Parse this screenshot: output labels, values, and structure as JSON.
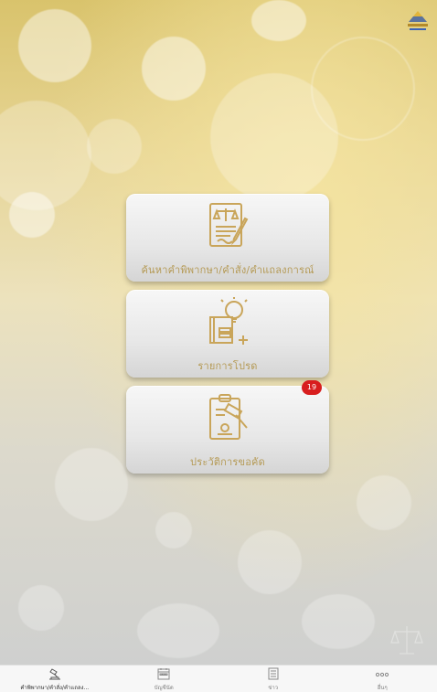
{
  "colors": {
    "gold": "#c9a55a",
    "badge": "#d81e1e",
    "label": "#b59a55"
  },
  "logo": {
    "icon": "court-logo-icon"
  },
  "menu": {
    "items": [
      {
        "id": "search",
        "label": "ค้นหาคำพิพากษา/คำสั่ง/คำแถลงการณ์",
        "icon": "legal-document-scales-icon"
      },
      {
        "id": "favorites",
        "label": "รายการโปรด",
        "icon": "book-lightbulb-icon"
      },
      {
        "id": "history",
        "label": "ประวัติการขอคัด",
        "icon": "clipboard-gavel-icon",
        "badge": "19"
      }
    ]
  },
  "tabbar": {
    "tabs": [
      {
        "label": "คำพิพากษา/คำสั่ง/คำแถลง...",
        "icon": "gavel-icon",
        "active": true
      },
      {
        "label": "บัญชีนัด",
        "icon": "calendar-icon",
        "active": false
      },
      {
        "label": "ข่าว",
        "icon": "news-icon",
        "active": false
      },
      {
        "label": "อื่นๆ",
        "icon": "more-icon",
        "active": false
      }
    ]
  }
}
